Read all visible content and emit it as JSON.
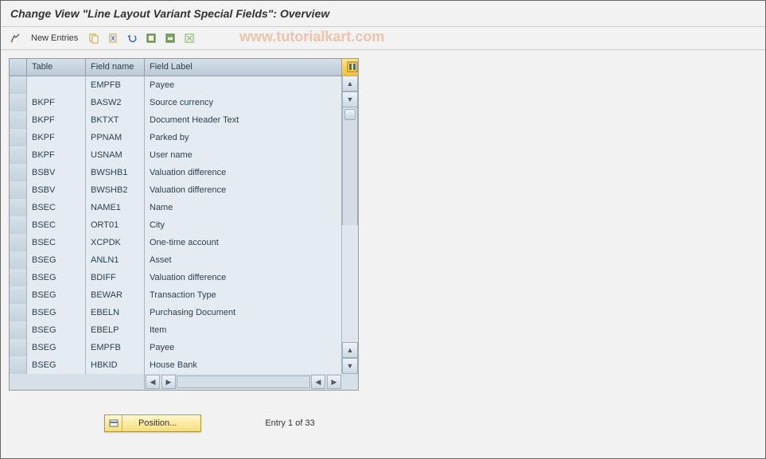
{
  "title": "Change View \"Line Layout Variant Special Fields\": Overview",
  "toolbar": {
    "new_entries": "New Entries"
  },
  "watermark": "www.tutorialkart.com",
  "grid": {
    "headers": {
      "table": "Table",
      "field_name": "Field name",
      "field_label": "Field Label"
    },
    "rows": [
      {
        "table": "",
        "field": "EMPFB",
        "label": "Payee"
      },
      {
        "table": "BKPF",
        "field": "BASW2",
        "label": "Source currency"
      },
      {
        "table": "BKPF",
        "field": "BKTXT",
        "label": "Document Header Text"
      },
      {
        "table": "BKPF",
        "field": "PPNAM",
        "label": "Parked by"
      },
      {
        "table": "BKPF",
        "field": "USNAM",
        "label": "User name"
      },
      {
        "table": "BSBV",
        "field": "BWSHB1",
        "label": "Valuation difference"
      },
      {
        "table": "BSBV",
        "field": "BWSHB2",
        "label": "Valuation difference"
      },
      {
        "table": "BSEC",
        "field": "NAME1",
        "label": "Name"
      },
      {
        "table": "BSEC",
        "field": "ORT01",
        "label": "City"
      },
      {
        "table": "BSEC",
        "field": "XCPDK",
        "label": "One-time account"
      },
      {
        "table": "BSEG",
        "field": "ANLN1",
        "label": "Asset"
      },
      {
        "table": "BSEG",
        "field": "BDIFF",
        "label": "Valuation difference"
      },
      {
        "table": "BSEG",
        "field": "BEWAR",
        "label": "Transaction Type"
      },
      {
        "table": "BSEG",
        "field": "EBELN",
        "label": "Purchasing Document"
      },
      {
        "table": "BSEG",
        "field": "EBELP",
        "label": "Item"
      },
      {
        "table": "BSEG",
        "field": "EMPFB",
        "label": "Payee"
      },
      {
        "table": "BSEG",
        "field": "HBKID",
        "label": "House Bank"
      }
    ]
  },
  "footer": {
    "position_label": "Position...",
    "entry_text": "Entry 1 of 33"
  }
}
